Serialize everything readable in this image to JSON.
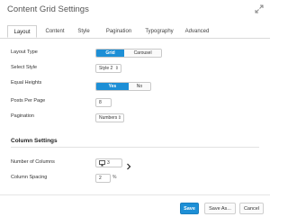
{
  "header": {
    "title": "Content Grid Settings",
    "expand_icon": "expand-icon"
  },
  "tabs": [
    {
      "label": "Layout",
      "active": true
    },
    {
      "label": "Content",
      "active": false
    },
    {
      "label": "Style",
      "active": false
    },
    {
      "label": "Pagination",
      "active": false
    },
    {
      "label": "Typography",
      "active": false
    },
    {
      "label": "Advanced",
      "active": false
    }
  ],
  "layout_type": {
    "label": "Layout Type",
    "options": [
      "Grid",
      "Carousel"
    ],
    "selected": "Grid"
  },
  "select_style": {
    "label": "Select Style",
    "value": "Style 2"
  },
  "equal_heights": {
    "label": "Equal Heights",
    "options": [
      "Yes",
      "No"
    ],
    "selected": "Yes"
  },
  "posts_per_page": {
    "label": "Posts Per Page",
    "value": "8"
  },
  "pagination": {
    "label": "Pagination",
    "value": "Numbers"
  },
  "column_settings": {
    "title": "Column Settings",
    "number_of_columns": {
      "label": "Number of Columns",
      "value": "3",
      "device_icon": "desktop-icon"
    },
    "column_spacing": {
      "label": "Column Spacing",
      "value": "2",
      "unit": "%"
    }
  },
  "footer": {
    "save": "Save",
    "save_as": "Save As...",
    "cancel": "Cancel"
  },
  "colors": {
    "accent": "#1d8fd6"
  }
}
